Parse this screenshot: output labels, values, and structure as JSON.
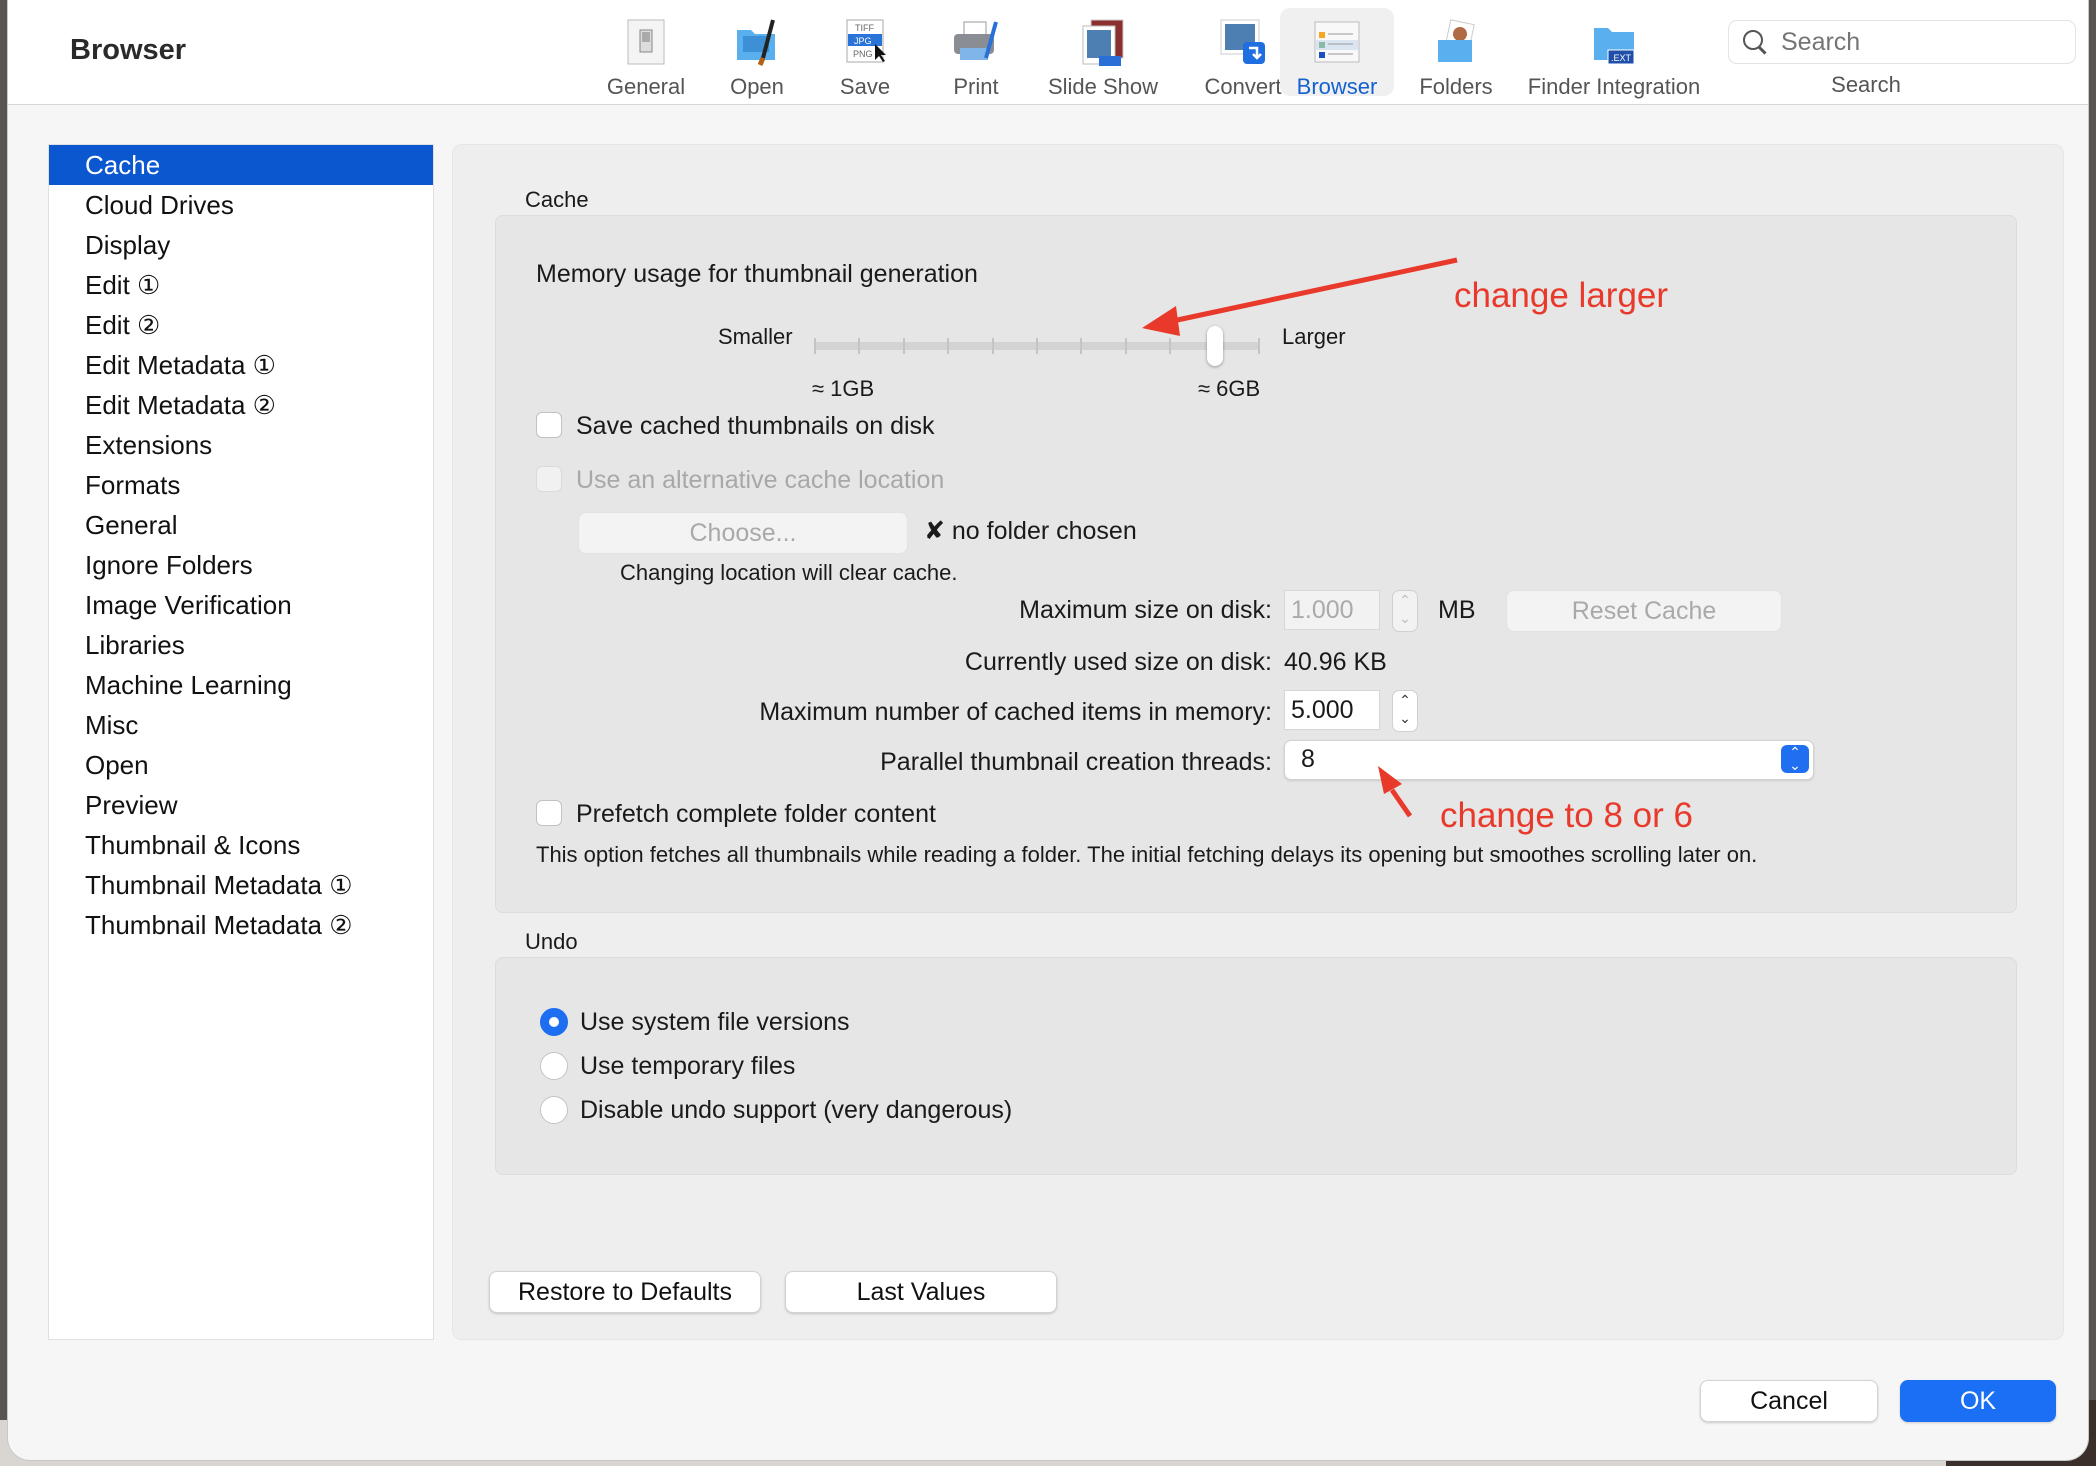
{
  "window": {
    "title": "Browser"
  },
  "toolbar": {
    "items": [
      {
        "label": "General",
        "icon": "switch-icon"
      },
      {
        "label": "Open",
        "icon": "folder-brush-icon"
      },
      {
        "label": "Save",
        "icon": "file-formats-icon"
      },
      {
        "label": "Print",
        "icon": "printer-icon"
      },
      {
        "label": "Slide Show",
        "icon": "slideshow-icon"
      },
      {
        "label": "Convert",
        "icon": "convert-icon"
      },
      {
        "label": "Browser",
        "icon": "browser-list-icon",
        "active": true
      },
      {
        "label": "Folders",
        "icon": "folder-person-icon"
      },
      {
        "label": "Finder Integration",
        "icon": "folder-ext-icon"
      }
    ],
    "search": {
      "placeholder": "Search",
      "label": "Search"
    }
  },
  "sidebar": {
    "selected": "Cache",
    "items": [
      "Cache",
      "Cloud Drives",
      "Display",
      "Edit ①",
      "Edit ②",
      "Edit Metadata ①",
      "Edit Metadata ②",
      "Extensions",
      "Formats",
      "General",
      "Ignore Folders",
      "Image Verification",
      "Libraries",
      "Machine Learning",
      "Misc",
      "Open",
      "Preview",
      "Thumbnail & Icons",
      "Thumbnail Metadata ①",
      "Thumbnail Metadata ②"
    ]
  },
  "cache": {
    "title": "Cache",
    "memory_label": "Memory usage for thumbnail generation",
    "slider": {
      "min_label": "Smaller",
      "max_label": "Larger",
      "low_mark": "≈ 1GB",
      "high_mark": "≈ 6GB",
      "ticks": 11,
      "value_fraction": 0.9
    },
    "save_on_disk": {
      "label": "Save cached thumbnails on disk",
      "checked": false
    },
    "alt_location": {
      "label": "Use an alternative cache location",
      "checked": false,
      "disabled": true
    },
    "choose_button": "Choose...",
    "no_folder": "✘ no folder chosen",
    "location_note": "Changing location will clear cache.",
    "max_disk": {
      "label": "Maximum size on disk:",
      "value": "1.000",
      "unit": "MB"
    },
    "reset_button": "Reset Cache",
    "used_disk": {
      "label": "Currently used size on disk:",
      "value": "40.96 KB"
    },
    "max_items": {
      "label": "Maximum number of cached items in memory:",
      "value": "5.000"
    },
    "threads": {
      "label": "Parallel thumbnail creation threads:",
      "value": "8"
    },
    "prefetch": {
      "label": "Prefetch complete folder content",
      "checked": false
    },
    "prefetch_note": "This option fetches all thumbnails while reading a folder. The initial fetching delays its opening but smoothes scrolling later on."
  },
  "undo": {
    "title": "Undo",
    "options": [
      {
        "label": "Use system file versions",
        "selected": true
      },
      {
        "label": "Use temporary files",
        "selected": false
      },
      {
        "label": "Disable undo support (very dangerous)",
        "selected": false
      }
    ]
  },
  "buttons": {
    "restore": "Restore to Defaults",
    "last": "Last Values",
    "cancel": "Cancel",
    "ok": "OK"
  },
  "annotations": {
    "slider": "change larger",
    "threads": "change to 8 or 6",
    "color": "#e8392b"
  }
}
